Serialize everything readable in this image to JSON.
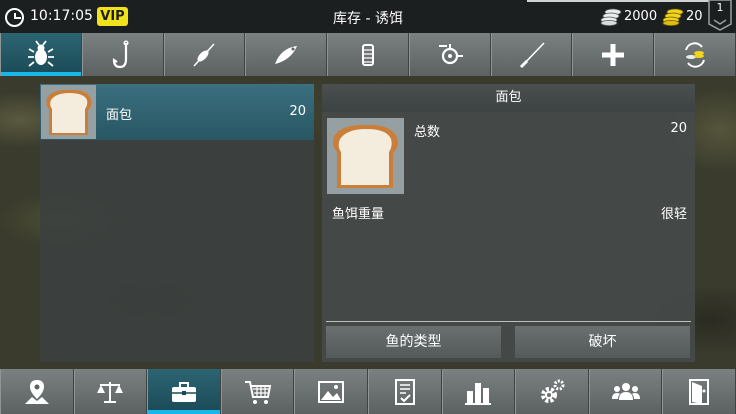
{
  "status": {
    "time": "10:17:05",
    "vip_label": "VIP",
    "title": "库存 - 诱饵",
    "silver": "2000",
    "gold": "20",
    "level": "1"
  },
  "tabs": [
    {
      "icon": "bug-icon",
      "active": true
    },
    {
      "icon": "hook-icon",
      "active": false
    },
    {
      "icon": "float-icon",
      "active": false
    },
    {
      "icon": "lure-icon",
      "active": false
    },
    {
      "icon": "line-icon",
      "active": false
    },
    {
      "icon": "reel-icon",
      "active": false
    },
    {
      "icon": "rod-icon",
      "active": false
    },
    {
      "icon": "plus-icon",
      "active": false
    },
    {
      "icon": "exchange-icon",
      "active": false
    }
  ],
  "list": {
    "items": [
      {
        "name": "面包",
        "count": "20",
        "icon": "bread-icon"
      }
    ]
  },
  "detail": {
    "header": "面包",
    "total_label": "总数",
    "total_value": "20",
    "weight_label": "鱼饵重量",
    "weight_value": "很轻",
    "fish_types_button": "鱼的类型",
    "destroy_button": "破坏"
  },
  "bottom_nav": [
    {
      "icon": "map-location-icon",
      "active": false
    },
    {
      "icon": "scales-icon",
      "active": false
    },
    {
      "icon": "toolbox-icon",
      "active": true
    },
    {
      "icon": "shopping-cart-icon",
      "active": false
    },
    {
      "icon": "gallery-icon",
      "active": false
    },
    {
      "icon": "checklist-icon",
      "active": false
    },
    {
      "icon": "bar-chart-icon",
      "active": false
    },
    {
      "icon": "settings-icon",
      "active": false
    },
    {
      "icon": "friends-icon",
      "active": false
    },
    {
      "icon": "exit-icon",
      "active": false
    }
  ],
  "colors": {
    "accent": "#19b7e8",
    "vip": "#f2e21c",
    "selected_item": "#2f6471"
  }
}
